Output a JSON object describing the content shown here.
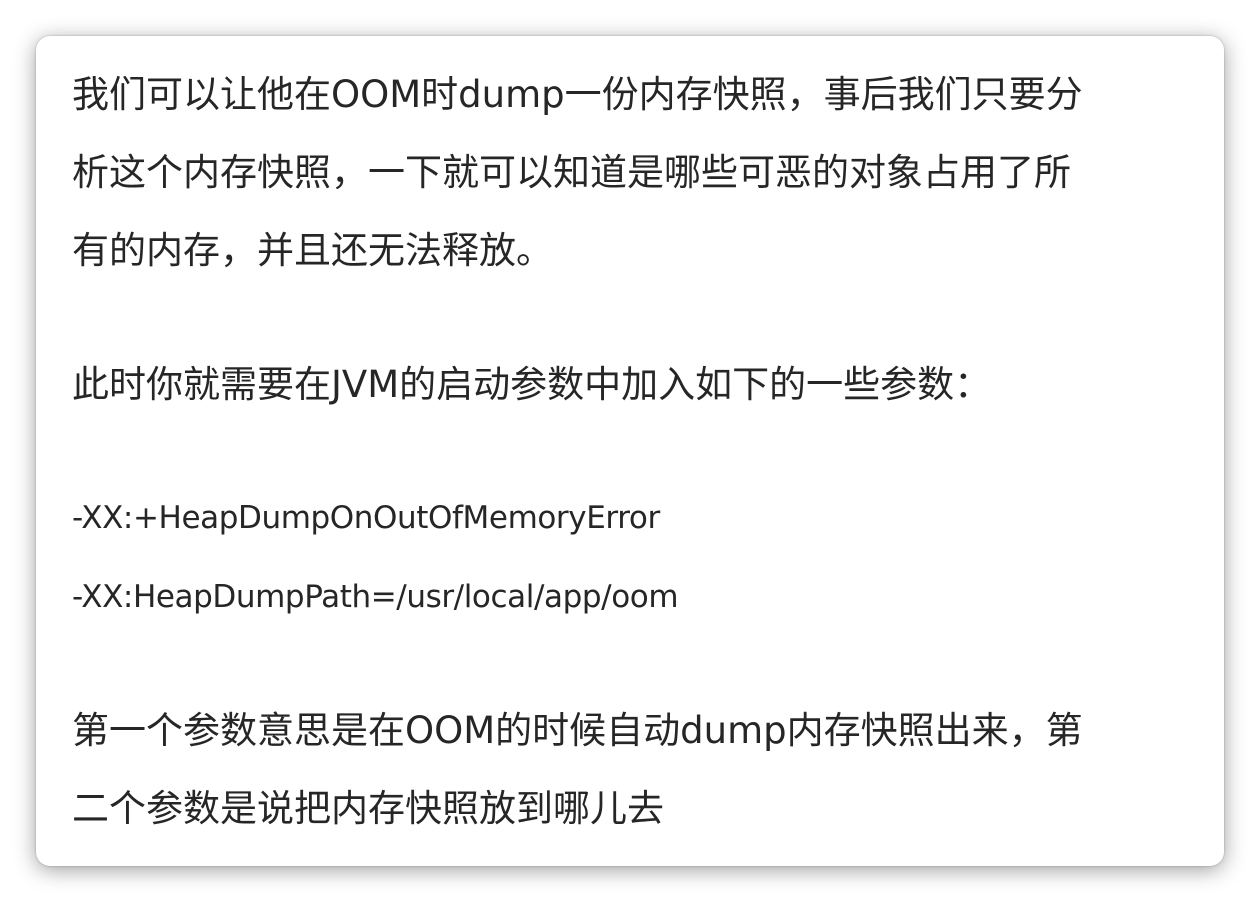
{
  "paragraph1": {
    "lines": [
      "我们可以让他在OOM时dump一份内存快照，事后我们只要分",
      "析这个内存快照，一下就可以知道是哪些可恶的对象占用了所",
      "有的内存，并且还无法释放。"
    ]
  },
  "paragraph2": "此时你就需要在JVM的启动参数中加入如下的一些参数：",
  "params": [
    "-XX:+HeapDumpOnOutOfMemoryError",
    "-XX:HeapDumpPath=/usr/local/app/oom"
  ],
  "paragraph3": {
    "lines": [
      "第一个参数意思是在OOM的时候自动dump内存快照出来，第",
      "二个参数是说把内存快照放到哪儿去"
    ]
  }
}
